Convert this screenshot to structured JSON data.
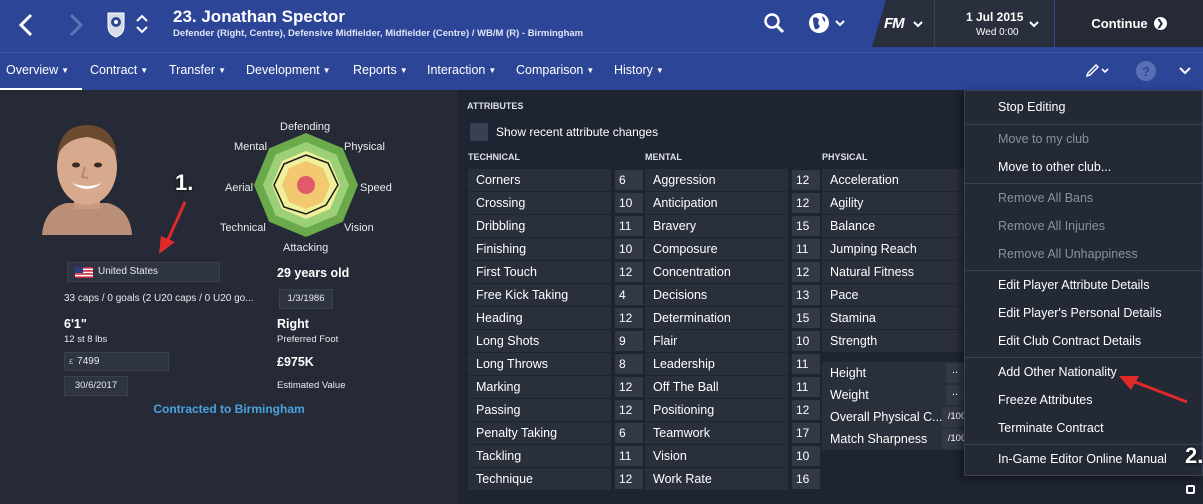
{
  "header": {
    "player_title": "23. Jonathan Spector",
    "player_subtitle": "Defender (Right, Centre), Defensive Midfielder, Midfielder (Centre) / WB/M (R) - Birmingham",
    "fm_label": "FM",
    "date": "1 Jul 2015",
    "time": "Wed 0:00",
    "continue_label": "Continue"
  },
  "tabs": [
    {
      "label": "Overview"
    },
    {
      "label": "Contract"
    },
    {
      "label": "Transfer"
    },
    {
      "label": "Development"
    },
    {
      "label": "Reports"
    },
    {
      "label": "Interaction"
    },
    {
      "label": "Comparison"
    },
    {
      "label": "History"
    }
  ],
  "profile": {
    "annotation_1": "1.",
    "nationality": "United States",
    "caps": "33 caps / 0 goals (2 U20 caps / 0 U20 go...",
    "age": "29 years old",
    "dob": "1/3/1986",
    "height": "6'1\"",
    "weight": "12 st 8 lbs",
    "foot": "Right",
    "foot_label": "Preferred Foot",
    "wage_currency": "£",
    "wage": "7499",
    "value": "£975K",
    "value_label": "Estimated Value",
    "contract_expiry": "30/6/2017",
    "contract_link": "Contracted to Birmingham"
  },
  "radar": {
    "labels": {
      "defending": "Defending",
      "physical": "Physical",
      "speed": "Speed",
      "vision": "Vision",
      "attacking": "Attacking",
      "technical": "Technical",
      "aerial": "Aerial",
      "mental": "Mental"
    }
  },
  "attributes": {
    "heading": "ATTRIBUTES",
    "show_changes_label": "Show recent attribute changes",
    "technical_heading": "TECHNICAL",
    "mental_heading": "MENTAL",
    "physical_heading": "PHYSICAL",
    "technical": [
      {
        "name": "Corners",
        "value": "6"
      },
      {
        "name": "Crossing",
        "value": "10"
      },
      {
        "name": "Dribbling",
        "value": "11"
      },
      {
        "name": "Finishing",
        "value": "10"
      },
      {
        "name": "First Touch",
        "value": "12"
      },
      {
        "name": "Free Kick Taking",
        "value": "4"
      },
      {
        "name": "Heading",
        "value": "12"
      },
      {
        "name": "Long Shots",
        "value": "9"
      },
      {
        "name": "Long Throws",
        "value": "8"
      },
      {
        "name": "Marking",
        "value": "12"
      },
      {
        "name": "Passing",
        "value": "12"
      },
      {
        "name": "Penalty Taking",
        "value": "6"
      },
      {
        "name": "Tackling",
        "value": "11"
      },
      {
        "name": "Technique",
        "value": "12"
      }
    ],
    "mental": [
      {
        "name": "Aggression",
        "value": "12"
      },
      {
        "name": "Anticipation",
        "value": "12"
      },
      {
        "name": "Bravery",
        "value": "15"
      },
      {
        "name": "Composure",
        "value": "11"
      },
      {
        "name": "Concentration",
        "value": "12"
      },
      {
        "name": "Decisions",
        "value": "13"
      },
      {
        "name": "Determination",
        "value": "15"
      },
      {
        "name": "Flair",
        "value": "10"
      },
      {
        "name": "Leadership",
        "value": "11"
      },
      {
        "name": "Off The Ball",
        "value": "11"
      },
      {
        "name": "Positioning",
        "value": "12"
      },
      {
        "name": "Teamwork",
        "value": "17"
      },
      {
        "name": "Vision",
        "value": "10"
      },
      {
        "name": "Work Rate",
        "value": "16"
      }
    ],
    "physical": [
      {
        "name": "Acceleration"
      },
      {
        "name": "Agility"
      },
      {
        "name": "Balance"
      },
      {
        "name": "Jumping Reach"
      },
      {
        "name": "Natural Fitness"
      },
      {
        "name": "Pace"
      },
      {
        "name": "Stamina"
      },
      {
        "name": "Strength"
      }
    ],
    "physical_extra": [
      {
        "name": "Height",
        "value": ".."
      },
      {
        "name": "Weight",
        "value": ".."
      },
      {
        "name": "Overall Physical C...",
        "value": "/100"
      },
      {
        "name": "Match Sharpness",
        "value": "/100"
      }
    ]
  },
  "menu": {
    "items": [
      {
        "label": "Stop Editing",
        "enabled": true
      },
      {
        "label": "Move to my club",
        "enabled": false
      },
      {
        "label": "Move to other club...",
        "enabled": true
      },
      {
        "label": "Remove All Bans",
        "enabled": false
      },
      {
        "label": "Remove All Injuries",
        "enabled": false
      },
      {
        "label": "Remove All Unhappiness",
        "enabled": false
      },
      {
        "label": "Edit Player Attribute Details",
        "enabled": true
      },
      {
        "label": "Edit Player's Personal Details",
        "enabled": true
      },
      {
        "label": "Edit Club Contract Details",
        "enabled": true
      },
      {
        "label": "Add Other Nationality",
        "enabled": true
      },
      {
        "label": "Freeze Attributes",
        "enabled": true
      },
      {
        "label": "Terminate Contract",
        "enabled": true
      },
      {
        "label": "In-Game Editor Online Manual",
        "enabled": true
      }
    ],
    "annotation_2": "2."
  },
  "colors": {
    "header_blue": "#2d4597",
    "panel_dark": "#262a36",
    "link_blue": "#4aa3df",
    "annotation_red": "#e02a2a"
  }
}
